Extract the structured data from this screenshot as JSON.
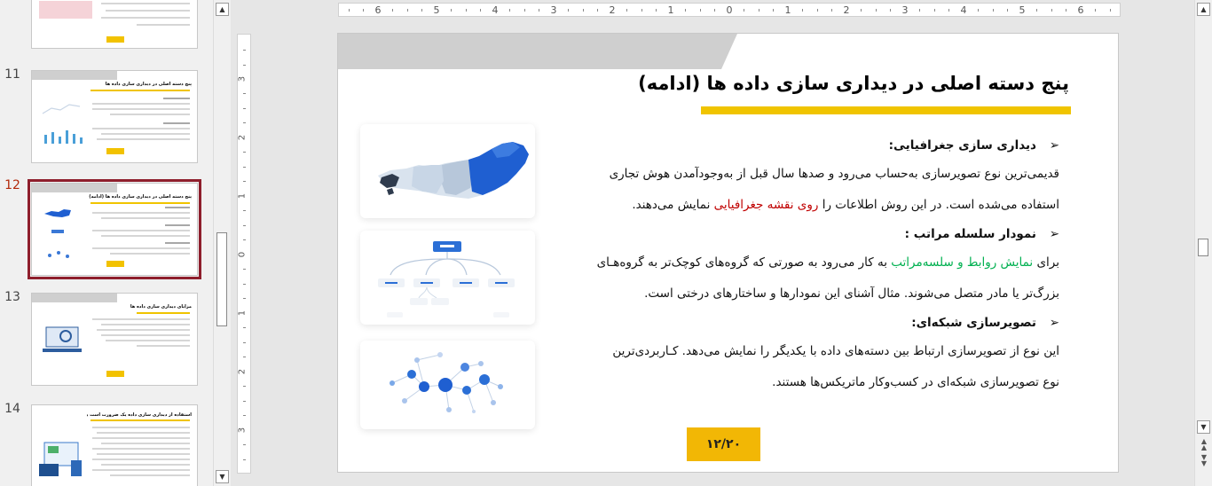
{
  "thumbnails": [
    {
      "number": "",
      "title": ""
    },
    {
      "number": "11",
      "title": "پنج دسته اصلی در دیداری سازی داده ها"
    },
    {
      "number": "12",
      "title": "پنج دسته اصلی در دیداری سازی داده ها (ادامه)"
    },
    {
      "number": "13",
      "title": "مزایای دیداری سازی داده ها"
    },
    {
      "number": "14",
      "title": "استفاده از دیداری سازی داده یک ضرورت است یا انتخاب؟"
    }
  ],
  "ruler": {
    "horizontal": [
      "6",
      "5",
      "4",
      "3",
      "2",
      "1",
      "0",
      "1",
      "2",
      "3",
      "4",
      "5",
      "6"
    ],
    "vertical": [
      "3",
      "2",
      "1",
      "0",
      "1",
      "2",
      "3"
    ]
  },
  "slide": {
    "title": "پنج دسته اصلی در دیداری سازی داده ها (ادامه)",
    "sections": [
      {
        "heading": "دیداری سازی جغرافیایی:",
        "line1": "قدیمی‌ترین نوع تصویرسازی به‌حساب می‌رود و صدها سال قبل از به‌وجودآمدن هوش تجاری",
        "line2_pre": "استفاده می‌شده است. در این روش اطلاعات را ",
        "line2_highlight": "روی نقشه جغرافیایی",
        "line2_post": " نمایش می‌دهند."
      },
      {
        "heading": "نمودار سلسله مراتب :",
        "line1_pre": "برای ",
        "line1_highlight": "نمایش روابط و سلسه‌مراتب",
        "line1_post": " به کار می‌رود به صورتی که گروه‌های کوچک‌تر به گروه‌هـای",
        "line2": "بزرگ‌تر یا مادر متصل می‌شوند.  مثال آشنای این نمودارها و ساختارهای درختی است."
      },
      {
        "heading": "تصویرسازی شبکه‌ای:",
        "line1": "این نوع از تصویرسازی ارتباط بین دسته‌های داده با یکدیگر را نمایش می‌دهد. کـاربردی‌ترین",
        "line2": "نوع تصویرسازی شبکه‌ای در کسب‌وکار ماتریکس‌ها هستند."
      }
    ],
    "number": "۱۲/۲۰",
    "colors": {
      "accent": "#f0c400",
      "red": "#c00000",
      "green": "#00b050",
      "map": "#1f5fd1"
    },
    "icons": [
      "russia-map-icon",
      "hierarchy-chart-icon",
      "network-graph-icon"
    ]
  }
}
